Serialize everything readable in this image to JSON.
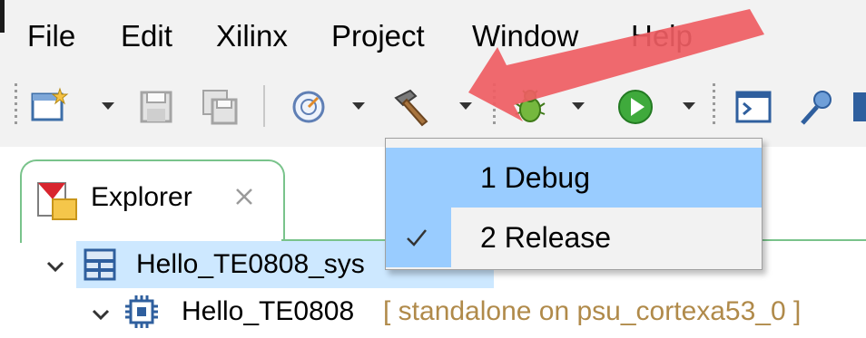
{
  "menu": {
    "items": [
      "File",
      "Edit",
      "Xilinx",
      "Project",
      "Window",
      "Help"
    ]
  },
  "toolbar": {
    "icons": [
      "new-file-icon",
      "save-icon",
      "save-all-icon",
      "build-config-icon",
      "build-hammer-icon",
      "debug-bug-icon",
      "run-play-icon",
      "terminal-icon",
      "connect-icon"
    ]
  },
  "dropdown_menu": {
    "items": [
      {
        "label": "1 Debug",
        "checked": false,
        "highlighted": true
      },
      {
        "label": "2 Release",
        "checked": true,
        "highlighted": false
      }
    ]
  },
  "explorer": {
    "tab_label": "Explorer",
    "tree": [
      {
        "label": "Hello_TE0808_sys",
        "decoration": "",
        "expanded": true
      },
      {
        "label": "Hello_TE0808",
        "decoration": "[ standalone on psu_cortexa53_0 ]",
        "expanded": true
      }
    ]
  },
  "colors": {
    "accent_arrow": "#ef5d63",
    "selection": "#cde8ff",
    "menu_highlight": "#99ccff",
    "tab_border": "#79c38b"
  }
}
